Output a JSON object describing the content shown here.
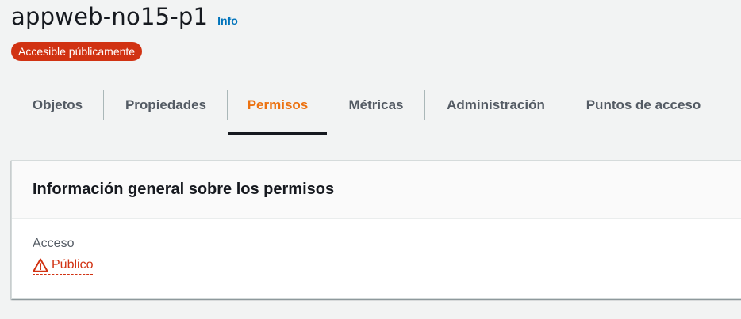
{
  "bucket": {
    "name": "appweb-no15-p1",
    "info_link": "Info",
    "badge": "Accesible públicamente"
  },
  "tabs": [
    {
      "label": "Objetos",
      "active": false
    },
    {
      "label": "Propiedades",
      "active": false
    },
    {
      "label": "Permisos",
      "active": true
    },
    {
      "label": "Métricas",
      "active": false
    },
    {
      "label": "Administración",
      "active": false
    },
    {
      "label": "Puntos de acceso",
      "active": false
    }
  ],
  "permissions_panel": {
    "title": "Información general sobre los permisos",
    "access_label": "Acceso",
    "access_value": "Público",
    "access_icon": "warning-icon"
  },
  "colors": {
    "accent_orange": "#ec7211",
    "danger_red": "#d13212",
    "link_blue": "#0073bb"
  }
}
